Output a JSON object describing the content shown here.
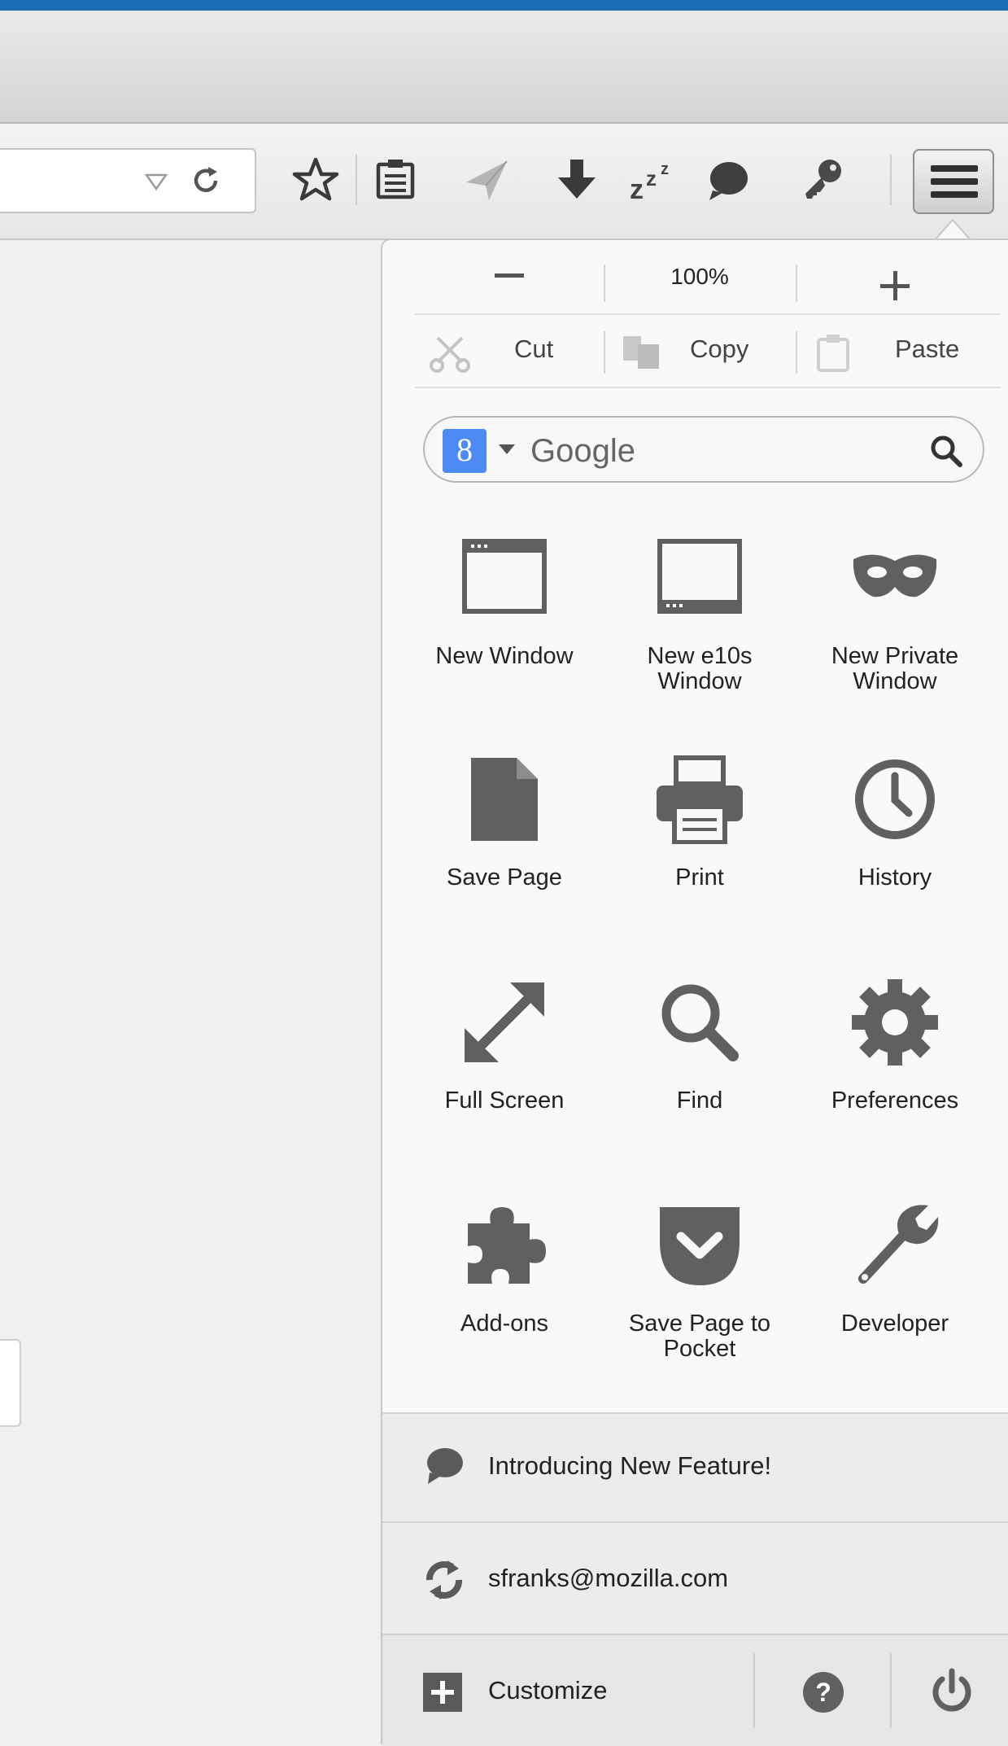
{
  "toolbar": {
    "icons": [
      "bookmark-star-icon",
      "reading-list-icon",
      "send-tab-icon",
      "downloads-icon",
      "sleep-icon",
      "chat-icon",
      "password-key-icon"
    ],
    "menu_button": "hamburger-menu-icon"
  },
  "panel": {
    "zoom": {
      "minus_label": "—",
      "level": "100%",
      "plus_label": "+"
    },
    "edit": {
      "cut": "Cut",
      "copy": "Copy",
      "paste": "Paste"
    },
    "search": {
      "engine_letter": "8",
      "placeholder": "Google"
    },
    "items": [
      {
        "label": "New Window",
        "icon": "window-icon"
      },
      {
        "label": "New e10s Window",
        "icon": "e10s-window-icon"
      },
      {
        "label": "New Private Window",
        "icon": "private-mask-icon"
      },
      {
        "label": "Save Page",
        "icon": "save-page-icon"
      },
      {
        "label": "Print",
        "icon": "printer-icon"
      },
      {
        "label": "History",
        "icon": "clock-icon"
      },
      {
        "label": "Full Screen",
        "icon": "fullscreen-arrows-icon"
      },
      {
        "label": "Find",
        "icon": "magnifier-icon"
      },
      {
        "label": "Preferences",
        "icon": "gear-icon"
      },
      {
        "label": "Add-ons",
        "icon": "puzzle-icon"
      },
      {
        "label": "Save Page to Pocket",
        "icon": "pocket-icon"
      },
      {
        "label": "Developer",
        "icon": "wrench-icon"
      }
    ],
    "footer": {
      "feature": "Introducing New Feature!",
      "account": "sfranks@mozilla.com",
      "customize": "Customize"
    }
  },
  "colors": {
    "accent_blue": "#1a6fb8",
    "icon_gray": "#606060",
    "engine_blue": "#4c8bf5"
  }
}
